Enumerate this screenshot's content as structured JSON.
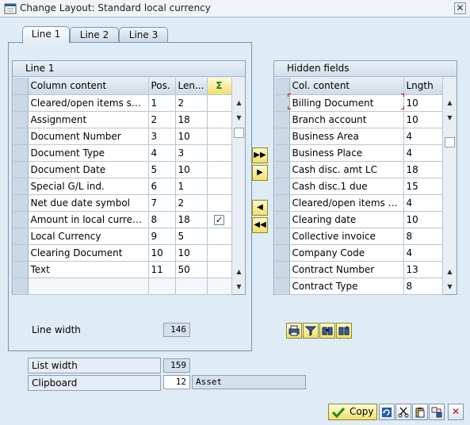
{
  "window": {
    "title": "Change Layout: Standard local currency",
    "close_label": "✕"
  },
  "tabs": [
    {
      "label": "Line 1",
      "active": true
    },
    {
      "label": "Line 2",
      "active": false
    },
    {
      "label": "Line 3",
      "active": false
    }
  ],
  "line1": {
    "title": "Line 1",
    "columns": [
      "Column content",
      "Pos.",
      "Len...",
      "Σ"
    ],
    "rows": [
      {
        "content": "Cleared/open items symbol",
        "pos": "1",
        "len": "2",
        "sum": false
      },
      {
        "content": "Assignment",
        "pos": "2",
        "len": "18",
        "sum": false
      },
      {
        "content": "Document Number",
        "pos": "3",
        "len": "10",
        "sum": false
      },
      {
        "content": "Document Type",
        "pos": "4",
        "len": "3",
        "sum": false
      },
      {
        "content": "Document Date",
        "pos": "5",
        "len": "10",
        "sum": false
      },
      {
        "content": "Special G/L ind.",
        "pos": "6",
        "len": "1",
        "sum": false
      },
      {
        "content": "Net due date symbol",
        "pos": "7",
        "len": "2",
        "sum": false
      },
      {
        "content": "Amount in local currency",
        "pos": "8",
        "len": "18",
        "sum": true
      },
      {
        "content": "Local Currency",
        "pos": "9",
        "len": "5",
        "sum": false
      },
      {
        "content": "Clearing Document",
        "pos": "10",
        "len": "10",
        "sum": false
      },
      {
        "content": "Text",
        "pos": "11",
        "len": "50",
        "sum": false
      },
      {
        "content": "",
        "pos": "",
        "len": "",
        "sum": false
      }
    ],
    "checkmark": "✓"
  },
  "hidden": {
    "title": "Hidden fields",
    "columns": [
      "Col. content",
      "Lngth"
    ],
    "rows": [
      {
        "content": "Billing Document",
        "len": "10"
      },
      {
        "content": "Branch account",
        "len": "10"
      },
      {
        "content": "Business Area",
        "len": "4"
      },
      {
        "content": "Business Place",
        "len": "4"
      },
      {
        "content": "Cash disc. amt LC",
        "len": "18"
      },
      {
        "content": "Cash disc.1 due",
        "len": "15"
      },
      {
        "content": "Cleared/open items symb...",
        "len": "4"
      },
      {
        "content": "Clearing date",
        "len": "10"
      },
      {
        "content": "Collective invoice",
        "len": "8"
      },
      {
        "content": "Company Code",
        "len": "4"
      },
      {
        "content": "Contract Number",
        "len": "13"
      },
      {
        "content": "Contract Type",
        "len": "8"
      }
    ]
  },
  "move_buttons": {
    "add_all": "▶▶",
    "add": "▶",
    "remove": "◀",
    "remove_all": "◀◀"
  },
  "line_width": {
    "label": "Line width",
    "value": "146"
  },
  "list_width": {
    "label": "List width",
    "value": "159"
  },
  "clipboard": {
    "label": "Clipboard",
    "value": "12",
    "name": "Asset"
  },
  "footer": {
    "copy_label": "Copy"
  },
  "colors": {
    "accent": "#f1df6a",
    "background": "#dfebf5",
    "cancel": "#cc0000",
    "confirm": "#1c8a1c"
  }
}
